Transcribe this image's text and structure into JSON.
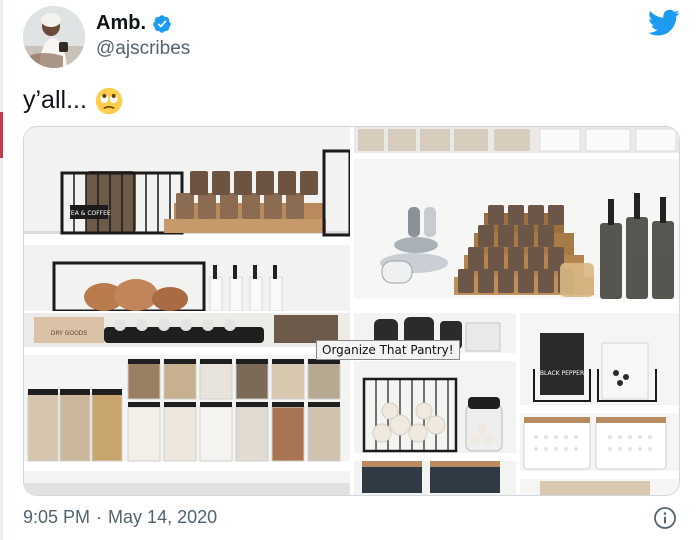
{
  "author": {
    "display_name": "Amb.",
    "handle": "@ajscribes",
    "verified": true
  },
  "tweet": {
    "text": "y’all...",
    "emoji": "face-with-rolling-eyes"
  },
  "media": {
    "tile_count": 4,
    "labels": {
      "tea_coffee": "TEA & COFFEE",
      "dry_goods": "DRY GOODS",
      "black_pepper": "BLACK PEPPER"
    },
    "tooltip": "Organize That Pantry!"
  },
  "footer": {
    "time": "9:05 PM",
    "separator": "·",
    "date": "May 14, 2020"
  },
  "colors": {
    "text": "#0f1419",
    "secondary": "#536471",
    "twitter_blue": "#1d9bf0",
    "border": "#cfd9de"
  },
  "icons": [
    "verified-badge-icon",
    "twitter-bird-icon",
    "info-icon"
  ]
}
